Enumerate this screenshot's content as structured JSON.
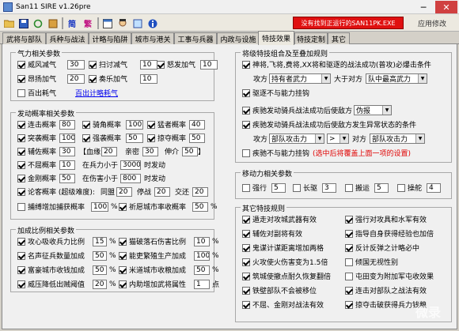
{
  "window": {
    "title": "San11 SIRE v1.26pre",
    "minimize": "─",
    "close": "✕"
  },
  "toolbar": {
    "simp": "简",
    "trad": "繁",
    "warning": "没有找到正运行的SAN11PK.EXE",
    "apply": "应用修改"
  },
  "tabs": [
    "武将与部队",
    "兵种与战法",
    "计略与陷阱",
    "城市与港关",
    "工事与兵器",
    "内政与设施",
    "特技效果",
    "特技定制",
    "其它"
  ],
  "left": {
    "g1": {
      "title": "气力相关参数",
      "r1": {
        "a": "威风减气",
        "av": "30",
        "b": "扫讨减气",
        "bv": "10",
        "c": "怒发加气",
        "cv": "10"
      },
      "r2": {
        "a": "昂扬加气",
        "av": "20",
        "b": "奏乐加气",
        "bv": "10"
      },
      "r3": {
        "a": "百出耗气",
        "link": "百出计略耗气"
      }
    },
    "g2": {
      "title": "发动概率相关参数",
      "r1": {
        "a": "连击概率",
        "av": "80",
        "b": "骑角概率",
        "bv": "100",
        "c": "猛者概率",
        "cv": "40"
      },
      "r2": {
        "a": "突袭概率",
        "av": "100",
        "b": "强袭概率",
        "bv": "50",
        "c": "掠夺概率",
        "cv": "50"
      },
      "r3": {
        "a": "辅佐概率",
        "av": "30",
        "l1": "【血缘",
        "v1": "20",
        "l2": "亲密",
        "v2": "30",
        "l3": "伸介",
        "v3": "50",
        "end": "】"
      },
      "r4": {
        "a": "不屈概率",
        "av": "10",
        "l1": "在兵力小于",
        "v1": "3000",
        "l2": "时发动"
      },
      "r5": {
        "a": "金刚概率",
        "av": "50",
        "l1": "在伤害小于",
        "v1": "800",
        "l2": "时发动"
      },
      "r6": {
        "a": "论客概率 (超级难度):",
        "l1": "同盟",
        "v1": "20",
        "l2": "停战",
        "v2": "20",
        "l3": "交还",
        "v3": "20"
      },
      "r7": {
        "a": "捕缚增加捕获概率",
        "av": "100",
        "u": "%",
        "b": "祈愿城市率收概率",
        "bv": "50",
        "u2": "%"
      }
    },
    "g3": {
      "title": "加成比例相关参数",
      "r1": {
        "a": "攻心吸收兵力比例",
        "av": "15",
        "u": "%",
        "b": "猫破落石伤害比例",
        "bv": "10",
        "u2": "%"
      },
      "r2": {
        "a": "名声征兵数量加成",
        "av": "50",
        "u": "%",
        "b": "能吏繁殖生产加成",
        "bv": "100",
        "u2": "%"
      },
      "r3": {
        "a": "富豪城市收钱加成",
        "av": "50",
        "u": "%",
        "b": "米道城市收粮加成",
        "bv": "50",
        "u2": "%"
      },
      "r4": {
        "a": "威压降低出贼阈值",
        "av": "20",
        "u": "%",
        "b": "内助增加武将属性",
        "bv": "1",
        "u2": "点"
      }
    }
  },
  "right": {
    "g1": {
      "title": "将级特技组合及至叠加规则",
      "c1": "神将,飞将,费将,XX将和驱逐的战法成功(普攻)必爆击条件",
      "l1": "攻方",
      "s1": "持有者武力",
      "l2": "大于对方",
      "s2": "队中最高武力",
      "c2": "驱逐不与能力挂钩",
      "c3": "疾驰发动骑兵战法成功后使敌方",
      "s3": "伪报",
      "c4": "疾驰发动骑兵战法成功后使敌方发生异常状态的条件",
      "l3": "攻方",
      "s4": "部队攻击力",
      "s5": ">",
      "l4": "对方",
      "s6": "部队攻击力",
      "c5": "疾驰不与能力挂钩",
      "note": "(选中后将覆盖上面一项的设置)"
    },
    "g2": {
      "title": "移动力相关参数",
      "a": "强行",
      "av": "5",
      "b": "长驱",
      "bv": "3",
      "c": "搬运",
      "cv": "5",
      "d": "操舵",
      "dv": "4"
    },
    "g3": {
      "title": "其它特技规则",
      "items": [
        [
          "遁走对攻城武器有效",
          "强行对攻具和水军有效"
        ],
        [
          "辅佐对副将有效",
          "指导自身获得经验也加倍"
        ],
        [
          "鬼谋计谋距离增加两格",
          "反计反弹之计略必中"
        ],
        [
          "火攻使火伤害变为1.5倍",
          "倾国无视性别"
        ],
        [
          "筑城使撤点耐久恢复翻倍",
          "屯田变为附加军屯收效果"
        ],
        [
          "铁壁部队不会被移位",
          "连击对部队之战法有效"
        ],
        [
          "不屈、金刚对战法有效",
          "掠夺击破获得兵力钱粮"
        ]
      ]
    }
  },
  "watermark": "微录"
}
